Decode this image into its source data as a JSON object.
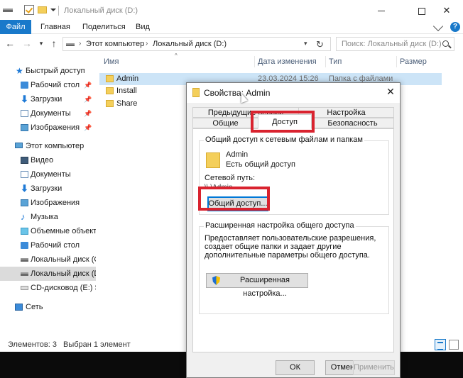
{
  "window": {
    "title": "Локальный диск (D:)"
  },
  "ribbon": {
    "tabs": [
      "Файл",
      "Главная",
      "Поделиться",
      "Вид"
    ]
  },
  "address": {
    "segments": [
      "Этот компьютер",
      "Локальный диск (D:)"
    ],
    "search_placeholder": "Поиск: Локальный диск (D:)"
  },
  "nav": {
    "items": [
      {
        "label": "Быстрый доступ",
        "icon": "star-icon",
        "pinned": false
      },
      {
        "label": "Рабочий стол",
        "icon": "desktop-folder-icon",
        "pinned": true
      },
      {
        "label": "Загрузки",
        "icon": "downloads-icon",
        "pinned": true
      },
      {
        "label": "Документы",
        "icon": "documents-icon",
        "pinned": true
      },
      {
        "label": "Изображения",
        "icon": "pictures-icon",
        "pinned": true
      },
      {
        "label": "Этот компьютер",
        "icon": "computer-icon",
        "pinned": false
      },
      {
        "label": "Видео",
        "icon": "video-icon",
        "pinned": false
      },
      {
        "label": "Документы",
        "icon": "documents-icon",
        "pinned": false
      },
      {
        "label": "Загрузки",
        "icon": "downloads-icon",
        "pinned": false
      },
      {
        "label": "Изображения",
        "icon": "pictures-icon",
        "pinned": false
      },
      {
        "label": "Музыка",
        "icon": "music-icon",
        "pinned": false
      },
      {
        "label": "Объемные объекты",
        "icon": "3d-objects-icon",
        "pinned": false
      },
      {
        "label": "Рабочий стол",
        "icon": "desktop-folder-icon",
        "pinned": false
      },
      {
        "label": "Локальный диск (C:)",
        "icon": "drive-icon",
        "pinned": false
      },
      {
        "label": "Локальный диск (D:)",
        "icon": "drive-icon",
        "pinned": false,
        "selected": true
      },
      {
        "label": "CD-дисковод (E:) SS",
        "icon": "cd-drive-icon",
        "pinned": false
      },
      {
        "label": "Сеть",
        "icon": "network-icon",
        "pinned": false
      }
    ]
  },
  "columns": [
    "Имя",
    "Дата изменения",
    "Тип",
    "Размер"
  ],
  "files": [
    {
      "name": "Admin",
      "date": "23.03.2024 15:26",
      "type": "Папка с файлами",
      "selected": true
    },
    {
      "name": "Install",
      "date": "",
      "type": "",
      "selected": false
    },
    {
      "name": "Share",
      "date": "",
      "type": "",
      "selected": false
    }
  ],
  "status": {
    "count": "Элементов: 3",
    "selection": "Выбран 1 элемент"
  },
  "dialog": {
    "title": "Свойства: Admin",
    "tabs": {
      "previous_versions": "Предыдущие версии",
      "settings": "Настройка",
      "general": "Общие",
      "access": "Доступ",
      "security": "Безопасность"
    },
    "share_group": {
      "title": "Общий доступ к сетевым файлам и папкам",
      "folder_name": "Admin",
      "status": "Есть общий доступ",
      "network_path_label": "Сетевой путь:",
      "network_path_value": "\\\\            \\Admin",
      "share_button": "Общий доступ..."
    },
    "advanced_group": {
      "title": "Расширенная настройка общего доступа",
      "description": "Предоставляет пользовательские разрешения, создает общие папки и задает другие дополнительные параметры общего доступа.",
      "button": "Расширенная настройка..."
    },
    "buttons": {
      "ok": "ОК",
      "cancel": "Отмена",
      "apply": "Применить"
    }
  },
  "colors": {
    "accent": "#1979ca",
    "highlight": "#d9232f",
    "selection": "#cce4f7",
    "folder": "#f4cf5b"
  }
}
